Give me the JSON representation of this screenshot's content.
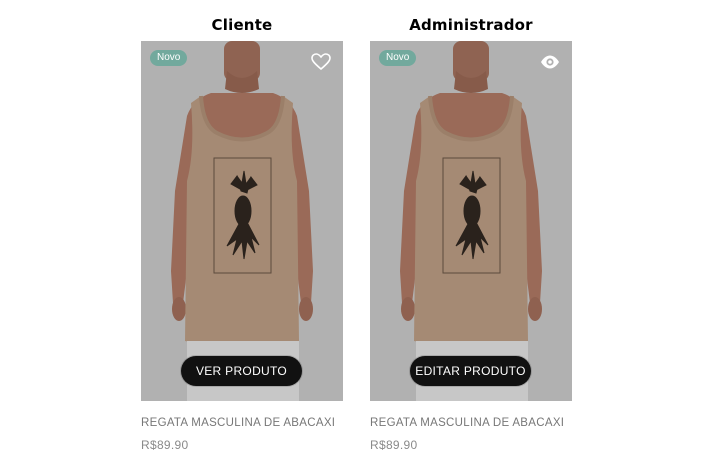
{
  "columns": [
    {
      "title": "Cliente",
      "badge": "Novo",
      "icon": "heart-outline",
      "button_label": "VER PRODUTO",
      "product_name": "REGATA MASCULINA DE ABACAXI",
      "price": "R$89.90"
    },
    {
      "title": "Administrador",
      "badge": "Novo",
      "icon": "eye",
      "button_label": "EDITAR PRODUTO",
      "product_name": "REGATA MASCULINA DE ABACAXI",
      "price": "R$89.90"
    }
  ],
  "colors": {
    "card_background": "#b1b1b1",
    "badge_background": "#72a99d",
    "button_background": "#111111",
    "shirt": "#a58a74",
    "skin": "#9a6a58"
  }
}
